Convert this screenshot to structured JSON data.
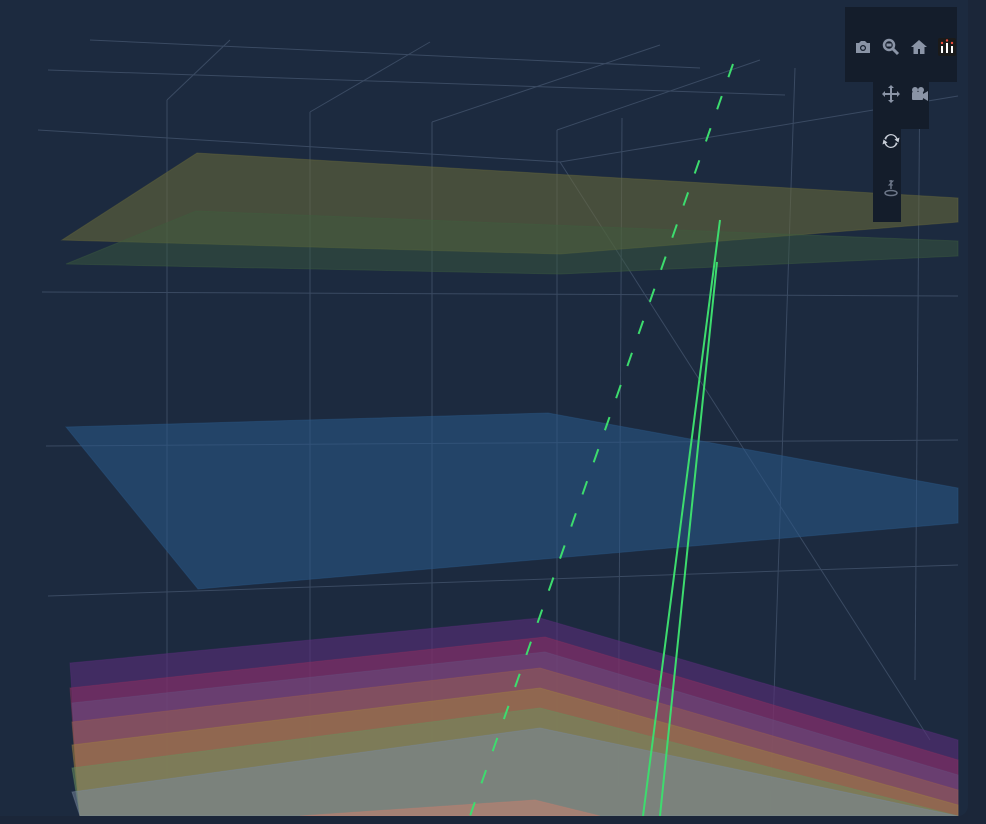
{
  "chart_data": {
    "type": "3d-surface-stack",
    "title": "",
    "theme": "dark",
    "grid": true,
    "surfaces": [
      {
        "color": "#6b6b3a",
        "opacity": 0.55
      },
      {
        "color": "#3e5e3e",
        "opacity": 0.45
      },
      {
        "color": "#2a5a8a",
        "opacity": 0.55
      },
      {
        "color": "#5a2e7a",
        "opacity": 0.6
      },
      {
        "color": "#8a3060",
        "opacity": 0.55
      },
      {
        "color": "#6a5080",
        "opacity": 0.5
      },
      {
        "color": "#9a6050",
        "opacity": 0.5
      },
      {
        "color": "#a08040",
        "opacity": 0.5
      },
      {
        "color": "#6a9060",
        "opacity": 0.5
      },
      {
        "color": "#7a8aa0",
        "opacity": 0.5
      },
      {
        "color": "#c08070",
        "opacity": 0.6
      }
    ],
    "traces": [
      {
        "style": "solid",
        "color": "#3ddc6e"
      },
      {
        "style": "solid",
        "color": "#3ddc6e"
      },
      {
        "style": "dashed",
        "color": "#3ddc6e"
      }
    ]
  },
  "modebar": {
    "buttons": [
      {
        "name": "camera-icon"
      },
      {
        "name": "zoom-icon"
      },
      {
        "name": "home-icon"
      },
      {
        "name": "plotly-logo-icon"
      },
      {
        "name": "pan-icon"
      },
      {
        "name": "orbit-camera-icon"
      },
      {
        "name": "turntable-rotation-icon"
      },
      {
        "name": "reset-axis-z-icon"
      }
    ]
  }
}
